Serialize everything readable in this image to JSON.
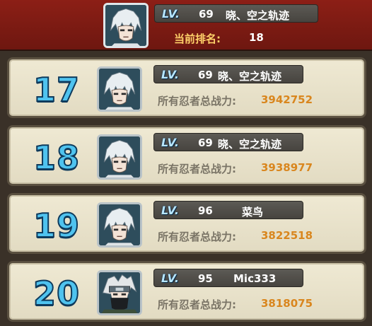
{
  "header": {
    "lv_label": "LV.",
    "level": "69",
    "name": "晓、空之轨迹",
    "rank_label": "当前排名:",
    "rank_value": "18",
    "avatar": "white-haired-ninja-portrait"
  },
  "power_label": "所有忍者总战力:",
  "rows": [
    {
      "rank": "17",
      "lv_label": "LV.",
      "level": "69",
      "name": "晓、空之轨迹",
      "power": "3942752",
      "avatar": "white-haired-ninja-portrait"
    },
    {
      "rank": "18",
      "lv_label": "LV.",
      "level": "69",
      "name": "晓、空之轨迹",
      "power": "3938977",
      "avatar": "white-haired-ninja-portrait"
    },
    {
      "rank": "19",
      "lv_label": "LV.",
      "level": "96",
      "name": "菜鸟",
      "power": "3822518",
      "avatar": "white-haired-ninja-portrait"
    },
    {
      "rank": "20",
      "lv_label": "LV.",
      "level": "95",
      "name": "Mic333",
      "power": "3818075",
      "avatar": "masked-ninja-portrait"
    }
  ],
  "colors": {
    "header_bg": "#7e1b13",
    "row_bg": "#e9e3cb",
    "rank_number": "#4fc3ef",
    "lv_text": "#b7e6ff",
    "power_value": "#d9861e",
    "rank_label": "#ffd26a"
  }
}
